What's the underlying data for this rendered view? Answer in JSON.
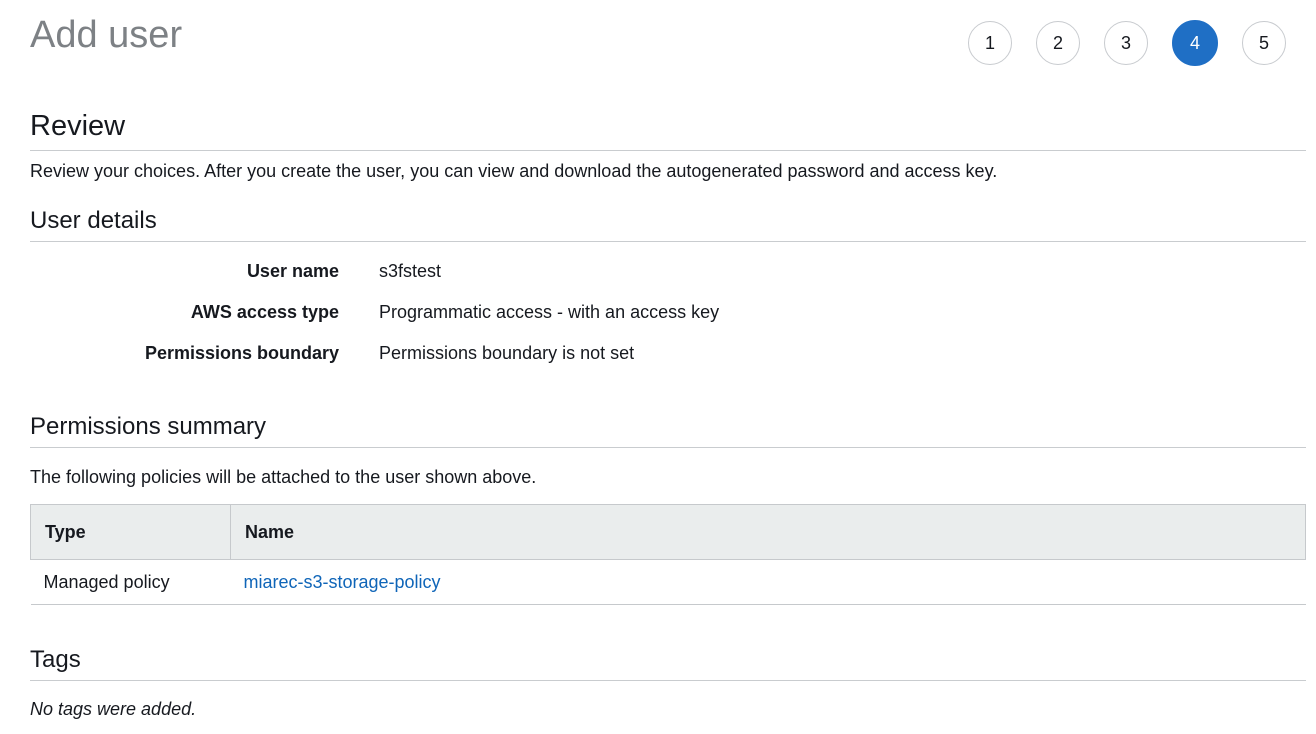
{
  "header": {
    "title": "Add user",
    "steps": [
      {
        "label": "1"
      },
      {
        "label": "2"
      },
      {
        "label": "3"
      },
      {
        "label": "4",
        "active": true
      },
      {
        "label": "5"
      }
    ],
    "active_step": 4
  },
  "review": {
    "heading": "Review",
    "description": "Review your choices. After you create the user, you can view and download the autogenerated password and access key."
  },
  "user_details": {
    "heading": "User details",
    "rows": [
      {
        "label": "User name",
        "value": "s3fstest"
      },
      {
        "label": "AWS access type",
        "value": "Programmatic access - with an access key"
      },
      {
        "label": "Permissions boundary",
        "value": "Permissions boundary is not set"
      }
    ]
  },
  "permissions": {
    "heading": "Permissions summary",
    "description": "The following policies will be attached to the user shown above.",
    "columns": [
      "Type",
      "Name"
    ],
    "rows": [
      {
        "type": "Managed policy",
        "name": "miarec-s3-storage-policy"
      }
    ]
  },
  "tags": {
    "heading": "Tags",
    "empty_text": "No tags were added."
  },
  "colors": {
    "accent": "#1f6fc5",
    "link": "#0f65b8",
    "title_gray": "#7d8185"
  }
}
